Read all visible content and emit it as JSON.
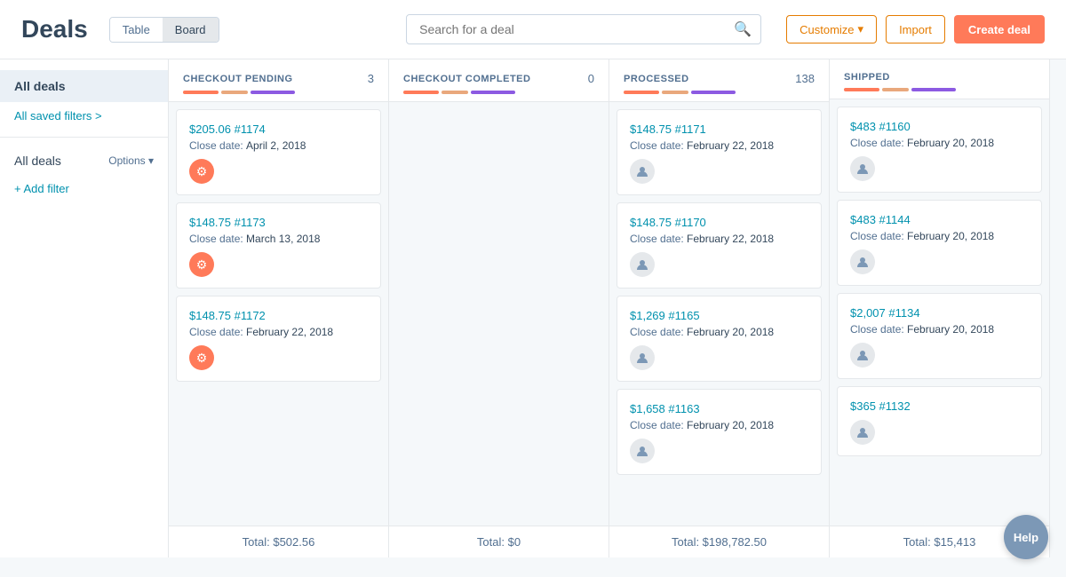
{
  "header": {
    "title": "Deals",
    "view_table_label": "Table",
    "view_board_label": "Board",
    "search_placeholder": "Search for a deal",
    "customize_label": "Customize",
    "import_label": "Import",
    "create_deal_label": "Create deal"
  },
  "sidebar": {
    "all_deals_label": "All deals",
    "saved_filters_label": "All saved filters >",
    "deals_label": "All deals",
    "options_label": "Options ▾",
    "add_filter_label": "+ Add filter"
  },
  "columns": [
    {
      "id": "checkout-pending",
      "title": "CHECKOUT PENDING",
      "count": "3",
      "bars": [
        "#ff7a59",
        "#e9a87c",
        "#8c5ae2"
      ],
      "cards": [
        {
          "id": "c1",
          "title": "$205.06 #1174",
          "date_label": "Close date:",
          "date": "April 2, 2018",
          "avatar": "hs"
        },
        {
          "id": "c2",
          "title": "$148.75 #1173",
          "date_label": "Close date:",
          "date": "March 13, 2018",
          "avatar": "hs"
        },
        {
          "id": "c3",
          "title": "$148.75 #1172",
          "date_label": "Close date:",
          "date": "February 22, 2018",
          "avatar": "hs"
        }
      ],
      "footer": "Total: $502.56"
    },
    {
      "id": "checkout-completed",
      "title": "CHECKOUT COMPLETED",
      "count": "0",
      "bars": [
        "#ff7a59",
        "#e9a87c",
        "#8c5ae2"
      ],
      "cards": [],
      "footer": "Total: $0"
    },
    {
      "id": "processed",
      "title": "PROCESSED",
      "count": "138",
      "bars": [
        "#ff7a59",
        "#e9a87c",
        "#8c5ae2"
      ],
      "cards": [
        {
          "id": "p1",
          "title": "$148.75 #1171",
          "date_label": "Close date:",
          "date": "February 22, 2018",
          "avatar": "user"
        },
        {
          "id": "p2",
          "title": "$148.75 #1170",
          "date_label": "Close date:",
          "date": "February 22, 2018",
          "avatar": "user"
        },
        {
          "id": "p3",
          "title": "$1,269 #1165",
          "date_label": "Close date:",
          "date": "February 20, 2018",
          "avatar": "user"
        },
        {
          "id": "p4",
          "title": "$1,658 #1163",
          "date_label": "Close date:",
          "date": "February 20, 2018",
          "avatar": "user"
        }
      ],
      "footer": "Total: $198,782.50"
    },
    {
      "id": "shipped",
      "title": "SHIPPED",
      "count": "",
      "bars": [
        "#ff7a59",
        "#e9a87c",
        "#8c5ae2"
      ],
      "cards": [
        {
          "id": "s1",
          "title": "$483 #1160",
          "date_label": "Close date:",
          "date": "February 20, 2018",
          "avatar": "user"
        },
        {
          "id": "s2",
          "title": "$483 #1144",
          "date_label": "Close date:",
          "date": "February 20, 2018",
          "avatar": "user"
        },
        {
          "id": "s3",
          "title": "$2,007 #1134",
          "date_label": "Close date:",
          "date": "February 20, 2018",
          "avatar": "user"
        },
        {
          "id": "s4",
          "title": "$365 #1132",
          "date_label": "Close date:",
          "date": "",
          "avatar": "user"
        }
      ],
      "footer": "Total: $15,413"
    }
  ],
  "help_label": "Help"
}
